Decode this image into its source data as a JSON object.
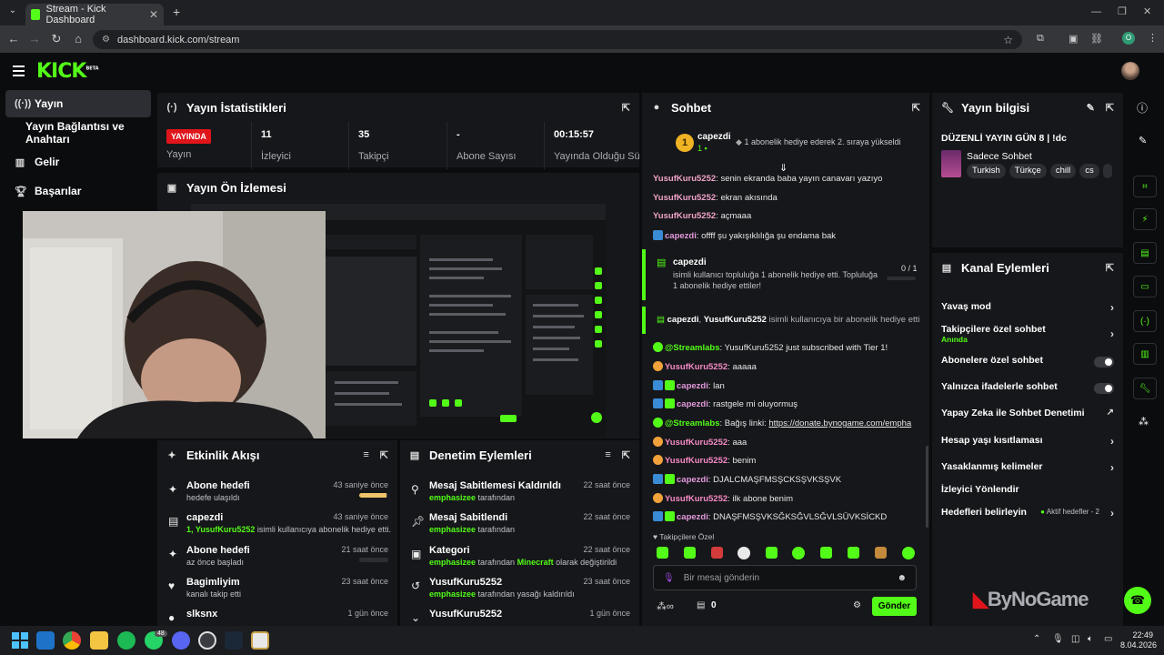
{
  "browser": {
    "tab_title": "Stream - Kick Dashboard",
    "url": "dashboard.kick.com/stream",
    "profile_initial": "O"
  },
  "app": {
    "logo": "KICK",
    "logo_sup": "BETA"
  },
  "nav": {
    "items": [
      {
        "label": "Yayın",
        "icon": "broadcast-icon"
      },
      {
        "label": "Yayın Bağlantısı ve Anahtarı",
        "icon": ""
      },
      {
        "label": "Gelir",
        "icon": "chart-icon"
      },
      {
        "label": "Başarılar",
        "icon": "trophy-icon"
      }
    ]
  },
  "stats": {
    "title": "Yayın İstatistikleri",
    "live_badge": "YAYINDA",
    "live_label": "Yayın",
    "viewers_value": "11",
    "viewers_label": "İzleyici",
    "followers_value": "35",
    "followers_label": "Takipçi",
    "subs_value": "-",
    "subs_label": "Abone Sayısı",
    "duration_value": "00:15:57",
    "duration_label": "Yayında Olduğu Süre"
  },
  "preview": {
    "title": "Yayın Ön İzlemesi"
  },
  "activity": {
    "title": "Etkinlik Akışı",
    "rows": [
      {
        "title": "Abone hedefi",
        "detail": "hedefe ulaşıldı",
        "time": "43 saniye önce",
        "progress": 0.95
      },
      {
        "title": "capezdi",
        "detail_user": "1, YusufKuru5252",
        "detail": " isimli kullanıcıya abonelik hediye etti.",
        "time": "43 saniye önce"
      },
      {
        "title": "Abone hedefi",
        "detail": "az önce başladı",
        "time": "21 saat önce",
        "progress": 0.0
      },
      {
        "title": "Bagimliyim",
        "detail": "kanalı takip etti",
        "time": "23 saat önce"
      },
      {
        "title": "slksnx",
        "detail": "",
        "time": "1 gün önce"
      }
    ]
  },
  "moderation": {
    "title": "Denetim Eylemleri",
    "rows": [
      {
        "title": "Mesaj Sabitlemesi Kaldırıldı",
        "user": "emphasizee",
        "detail": " tarafından",
        "time": "22 saat önce"
      },
      {
        "title": "Mesaj Sabitlendi",
        "user": "emphasizee",
        "detail": " tarafından",
        "time": "22 saat önce"
      },
      {
        "title": "Kategori",
        "user": "emphasizee",
        "detail": " tarafından ",
        "extra": "Minecraft",
        "detail2": " olarak değiştirildi",
        "time": "22 saat önce"
      },
      {
        "title": "YusufKuru5252",
        "user": "emphasizee",
        "detail": " tarafından yasağı kaldırıldı",
        "time": "23 saat önce"
      },
      {
        "title": "YusufKuru5252",
        "user": "",
        "detail": "",
        "time": "1 gün önce"
      }
    ]
  },
  "chat": {
    "title": "Sohbet",
    "top_user": "capezdi",
    "top_rank": "1",
    "top_count": "1",
    "top_note": "1 abonelik hediye ederek 2. sıraya yükseldi",
    "messages": [
      {
        "user": "YusufKuru5252",
        "text": ": senin ekranda baba yayın canavarı yazıyo"
      },
      {
        "user": "YusufKuru5252",
        "text": ": ekran akısında"
      },
      {
        "user": "YusufKuru5252",
        "text": ": açmaaa"
      },
      {
        "user": "capezdi",
        "text": ": offff şu yakışıklılığa şu endama bak"
      }
    ],
    "gift_user": "capezdi",
    "gift_text": "isimli kullanıcı topluluğa 1 abonelik hediye etti. Topluluğa 1 abonelik hediye ettiler!",
    "gift_progress": "0 / 1",
    "gift2_user1": "capezdi",
    "gift2_user2": "YusufKuru5252",
    "gift2_text": " isimli kullanıcıya bir abonelik hediye etti",
    "messages2": [
      {
        "user": "@Streamlabs",
        "text": ": YusufKuru5252 just subscribed with Tier 1!"
      },
      {
        "user": "YusufKuru5252",
        "text": ": aaaaa"
      },
      {
        "user": "capezdi",
        "text": ": lan"
      },
      {
        "user": "capezdi",
        "text": ": rastgele mi oluyormuş"
      },
      {
        "user": "@Streamlabs",
        "text": ": Bağış linki: ",
        "link": "https://donate.bynogame.com/empha"
      },
      {
        "user": "YusufKuru5252",
        "text": ": aaa"
      },
      {
        "user": "YusufKuru5252",
        "text": ": benim"
      },
      {
        "user": "capezdi",
        "text": ": DJALCMAŞFMSŞCKSŞVKSŞVK"
      },
      {
        "user": "YusufKuru5252",
        "text": ": ilk abone benim"
      },
      {
        "user": "capezdi",
        "text": ": DNAŞFMSŞVKSĞKSĞVLSĞVLSÜVKSİCKD"
      }
    ],
    "followers_only": "Takipçilere Özel",
    "input_placeholder": "Bir mesaj gönderin",
    "points": "0",
    "send_label": "Gönder"
  },
  "stream_info": {
    "title": "Yayın bilgisi",
    "stream_title": "DÜZENLİ YAYIN GÜN 8 | !dc",
    "category": "Sadece Sohbet",
    "tags": [
      "Turkish",
      "Türkçe",
      "chill",
      "cs"
    ]
  },
  "channel_actions": {
    "title": "Kanal Eylemleri",
    "rows": [
      {
        "label": "Yavaş mod",
        "kind": "chevron"
      },
      {
        "label": "Takipçilere özel sohbet",
        "sub": "Anında",
        "kind": "chevron"
      },
      {
        "label": "Abonelere özel sohbet",
        "kind": "toggle"
      },
      {
        "label": "Yalnızca ifadelerle sohbet",
        "kind": "toggle"
      },
      {
        "label": "Yapay Zeka ile Sohbet Denetimi",
        "kind": "external"
      },
      {
        "label": "Hesap yaşı kısıtlaması",
        "kind": "chevron"
      },
      {
        "label": "Yasaklanmış kelimeler",
        "kind": "chevron"
      },
      {
        "label": "İzleyici Yönlendir",
        "kind": "none"
      },
      {
        "label": "Hedefleri belirleyin",
        "note": "Aktif hedefler - 2",
        "kind": "chevron"
      }
    ]
  },
  "watermark": "ByNoGame",
  "taskbar": {
    "whatsapp_badge": "48",
    "time": "22:49",
    "date": "8.04.2026"
  },
  "colors": {
    "accent": "#53fc18",
    "live": "#e0151b",
    "panel": "#16171a"
  }
}
